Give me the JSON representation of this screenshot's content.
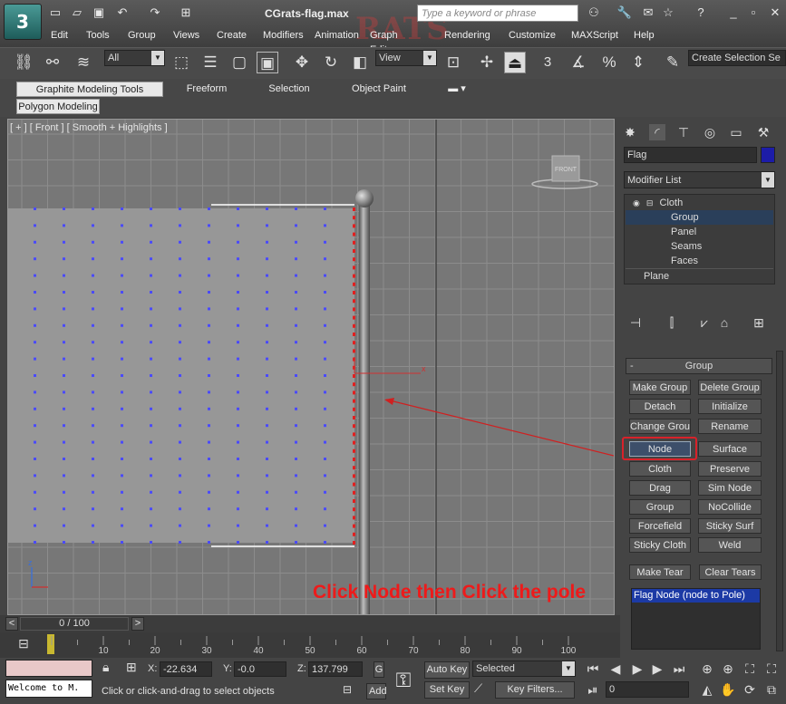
{
  "window": {
    "title": "CGrats-flag.max",
    "logo_text": "3",
    "watermark": "RATS"
  },
  "search": {
    "placeholder": "Type a keyword or phrase"
  },
  "menu": [
    "Edit",
    "Tools",
    "Group",
    "Views",
    "Create",
    "Modifiers",
    "Animation",
    "Graph Editors",
    "Rendering",
    "Customize",
    "MAXScript",
    "Help"
  ],
  "toolbar": {
    "selection_filter": "All",
    "ref_coord": "View",
    "snap_label": "3",
    "named_selection": "Create Selection Se"
  },
  "ribbon": {
    "tabs": [
      "Graphite Modeling Tools",
      "Freeform",
      "Selection",
      "Object Paint"
    ],
    "sub_tab": "Polygon Modeling"
  },
  "viewport": {
    "label": "[ + ] [ Front ] [ Smooth + Highlights ]",
    "viewcube_label": "FRONT",
    "annotation": "Click Node then Click the pole",
    "axis_label": "z",
    "gizmo_label": "x"
  },
  "command_panel": {
    "object_name": "Flag",
    "object_color": "#1c1ca8",
    "modifier_list": "Modifier List",
    "stack": [
      {
        "label": "Cloth",
        "level": 0
      },
      {
        "label": "Group",
        "level": 1
      },
      {
        "label": "Panel",
        "level": 1
      },
      {
        "label": "Seams",
        "level": 1
      },
      {
        "label": "Faces",
        "level": 1
      },
      {
        "label": "Plane",
        "level": 0
      }
    ],
    "rollout_title": "Group",
    "rollout_toggle": "-",
    "buttons": [
      [
        "Make Group",
        "Delete Group"
      ],
      [
        "Detach",
        "Initialize"
      ],
      [
        "Change Group",
        "Rename"
      ],
      [
        "Node",
        "Surface"
      ],
      [
        "Cloth",
        "Preserve"
      ],
      [
        "Drag",
        "Sim Node"
      ],
      [
        "Group",
        "NoCollide"
      ],
      [
        "Forcefield",
        "Sticky Surf"
      ],
      [
        "Sticky Cloth",
        "Weld"
      ]
    ],
    "tear_buttons": [
      "Make Tear",
      "Clear Tears"
    ],
    "group_list": [
      "Flag Node (node  to  Pole)"
    ]
  },
  "timeline": {
    "frame": "0 / 100",
    "ticks": [
      "10",
      "20",
      "30",
      "40",
      "50",
      "60",
      "70",
      "80",
      "90",
      "100"
    ],
    "tick_values": [
      10,
      20,
      30,
      40,
      50,
      60,
      70,
      80,
      90,
      100
    ]
  },
  "status": {
    "maxscript_listener": "Welcome to M.",
    "prompt": "Click or click-and-drag to select objects",
    "x_label": "X:",
    "x_value": "-22.634",
    "y_label": "Y:",
    "y_value": "-0.0",
    "z_label": "Z:",
    "z_value": "137.799",
    "g_label": "G",
    "add_label": "Add",
    "auto_key": "Auto Key",
    "set_key": "Set Key",
    "key_mode": "Selected",
    "key_filters": "Key Filters...",
    "current_frame": "0"
  }
}
